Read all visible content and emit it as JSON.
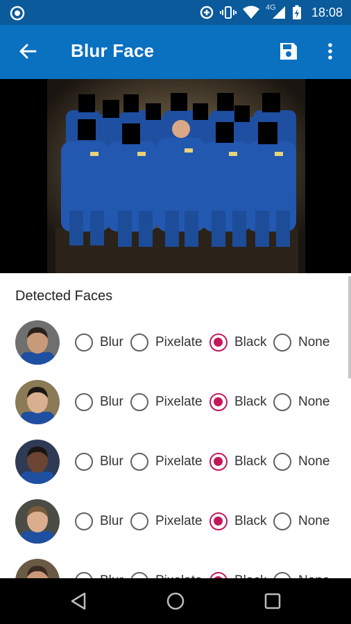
{
  "status_bar": {
    "network_label": "4G",
    "time": "18:08"
  },
  "app_bar": {
    "title": "Blur Face",
    "icons": [
      "back-arrow-icon",
      "save-icon",
      "more-vert-icon"
    ]
  },
  "detected_faces": {
    "title": "Detected Faces",
    "option_labels": [
      "Blur",
      "Pixelate",
      "Black",
      "None"
    ],
    "rows": [
      {
        "selected": "Black"
      },
      {
        "selected": "Black"
      },
      {
        "selected": "Black"
      },
      {
        "selected": "Black"
      },
      {
        "selected": "Black"
      }
    ]
  },
  "colors": {
    "status_bar": "#0a5a9c",
    "app_bar": "#0a70c0",
    "radio_accent": "#c2185b"
  }
}
